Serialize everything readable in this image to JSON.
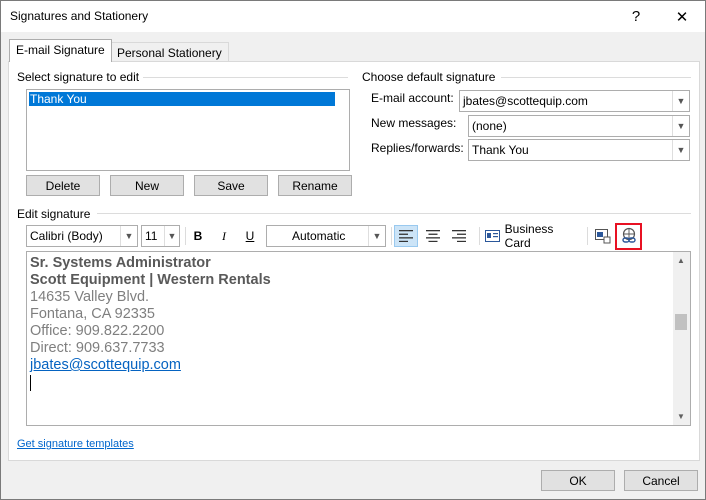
{
  "window": {
    "title": "Signatures and Stationery",
    "help_label": "?",
    "close_label": "✕"
  },
  "tabs": [
    {
      "label": "E-mail Signature",
      "active": true
    },
    {
      "label": "Personal Stationery",
      "active": false
    }
  ],
  "select_section": {
    "label": "Select signature to edit",
    "items": [
      "Thank You"
    ],
    "selected": "Thank You"
  },
  "list_buttons": {
    "delete": "Delete",
    "new": "New",
    "save": "Save",
    "rename": "Rename"
  },
  "default_section": {
    "label": "Choose default signature",
    "email_account_label": "E-mail account:",
    "email_account_value": "jbates@scottequip.com",
    "new_messages_label": "New messages:",
    "new_messages_value": "(none)",
    "replies_label": "Replies/forwards:",
    "replies_value": "Thank You"
  },
  "edit_section": {
    "label": "Edit signature",
    "font": "Calibri (Body)",
    "size": "11",
    "bold": "B",
    "italic": "I",
    "underline": "U",
    "color": "Automatic",
    "business_card": "Business Card"
  },
  "signature_lines": {
    "line1": "Sr. Systems Administrator",
    "line2": "Scott Equipment | Western Rentals",
    "line3": "14635 Valley Blvd.",
    "line4": "Fontana, CA 92335",
    "line5": "Office: 909.822.2200",
    "line6": "Direct: 909.637.7733",
    "line7": "jbates@scottequip.com"
  },
  "footer": {
    "templates_link": "Get signature templates",
    "ok": "OK",
    "cancel": "Cancel"
  },
  "colors": {
    "selection": "#0078d7",
    "highlight_box": "#e81123",
    "link": "#0066cc"
  }
}
